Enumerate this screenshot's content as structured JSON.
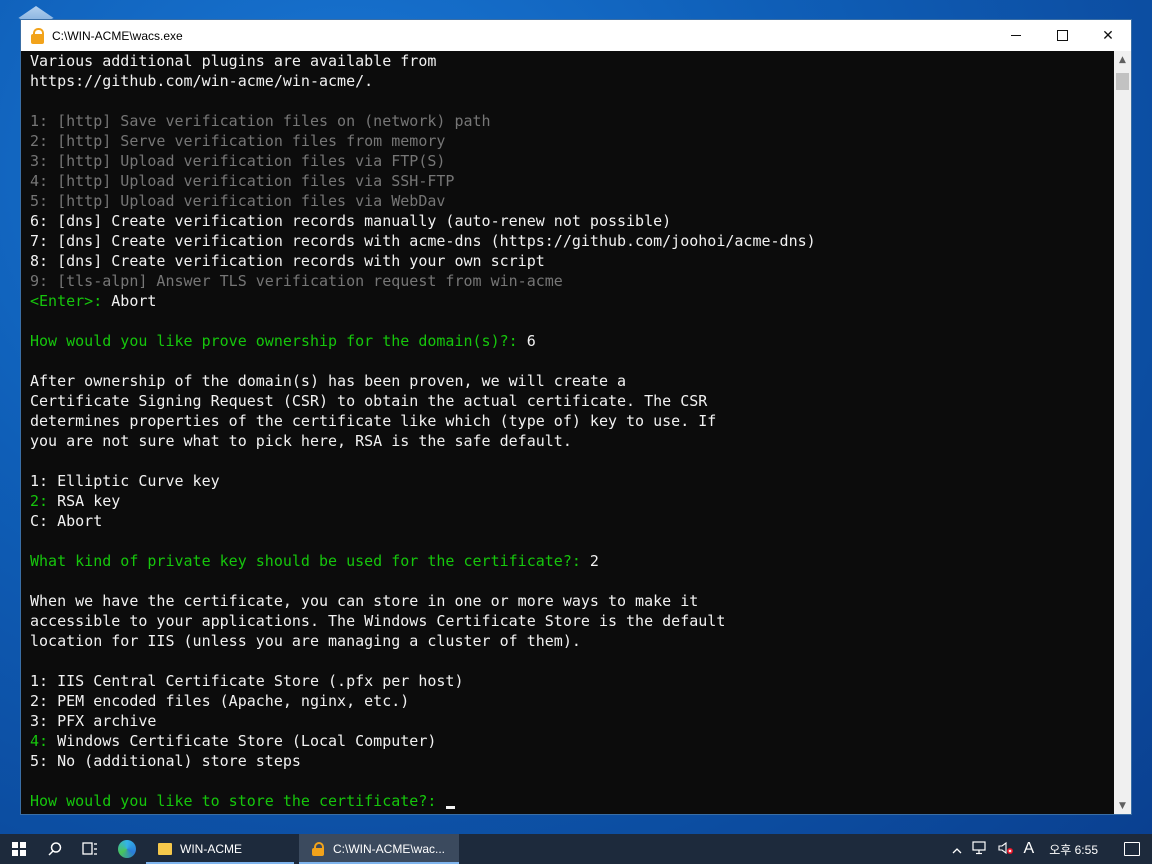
{
  "window": {
    "title": "C:\\WIN-ACME\\wacs.exe",
    "controls": {
      "minimize": "—",
      "maximize": "☐",
      "close": "✕"
    }
  },
  "console": {
    "lines": [
      [
        {
          "t": "Various additional plugins are available from",
          "c": "w"
        }
      ],
      [
        {
          "t": "https://github.com/win-acme/win-acme/.",
          "c": "w"
        }
      ],
      [],
      [
        {
          "t": "1: [http] Save verification files on (network) path",
          "c": "d"
        }
      ],
      [
        {
          "t": "2: [http] Serve verification files from memory",
          "c": "d"
        }
      ],
      [
        {
          "t": "3: [http] Upload verification files via FTP(S)",
          "c": "d"
        }
      ],
      [
        {
          "t": "4: [http] Upload verification files via SSH-FTP",
          "c": "d"
        }
      ],
      [
        {
          "t": "5: [http] Upload verification files via WebDav",
          "c": "d"
        }
      ],
      [
        {
          "t": "6: [dns] Create verification records manually (auto-renew not possible)",
          "c": "w"
        }
      ],
      [
        {
          "t": "7: [dns] Create verification records with acme-dns (https://github.com/joohoi/acme-dns)",
          "c": "w"
        }
      ],
      [
        {
          "t": "8: [dns] Create verification records with your own script",
          "c": "w"
        }
      ],
      [
        {
          "t": "9: [tls-alpn] Answer TLS verification request from win-acme",
          "c": "d"
        }
      ],
      [
        {
          "t": "<Enter>: ",
          "c": "g"
        },
        {
          "t": "Abort",
          "c": "w"
        }
      ],
      [],
      [
        {
          "t": "How would you like prove ownership for the domain(s)?: ",
          "c": "g"
        },
        {
          "t": "6",
          "c": "w"
        }
      ],
      [],
      [
        {
          "t": "After ownership of the domain(s) has been proven, we will create a",
          "c": "w"
        }
      ],
      [
        {
          "t": "Certificate Signing Request (CSR) to obtain the actual certificate. The CSR",
          "c": "w"
        }
      ],
      [
        {
          "t": "determines properties of the certificate like which (type of) key to use. If",
          "c": "w"
        }
      ],
      [
        {
          "t": "you are not sure what to pick here, RSA is the safe default.",
          "c": "w"
        }
      ],
      [],
      [
        {
          "t": "1: Elliptic Curve key",
          "c": "w"
        }
      ],
      [
        {
          "t": "2: ",
          "c": "g"
        },
        {
          "t": "RSA key",
          "c": "w"
        }
      ],
      [
        {
          "t": "C: Abort",
          "c": "w"
        }
      ],
      [],
      [
        {
          "t": "What kind of private key should be used for the certificate?: ",
          "c": "g"
        },
        {
          "t": "2",
          "c": "w"
        }
      ],
      [],
      [
        {
          "t": "When we have the certificate, you can store in one or more ways to make it",
          "c": "w"
        }
      ],
      [
        {
          "t": "accessible to your applications. The Windows Certificate Store is the default",
          "c": "w"
        }
      ],
      [
        {
          "t": "location for IIS (unless you are managing a cluster of them).",
          "c": "w"
        }
      ],
      [],
      [
        {
          "t": "1: IIS Central Certificate Store (.pfx per host)",
          "c": "w"
        }
      ],
      [
        {
          "t": "2: PEM encoded files (Apache, nginx, etc.)",
          "c": "w"
        }
      ],
      [
        {
          "t": "3: PFX archive",
          "c": "w"
        }
      ],
      [
        {
          "t": "4: ",
          "c": "g"
        },
        {
          "t": "Windows Certificate Store (Local Computer)",
          "c": "w"
        }
      ],
      [
        {
          "t": "5: No (additional) store steps",
          "c": "w"
        }
      ],
      [],
      [
        {
          "t": "How would you like to store the certificate?: ",
          "c": "g"
        }
      ]
    ]
  },
  "taskbar": {
    "items": [
      {
        "label": "WIN-ACME",
        "icon": "folder-icon"
      },
      {
        "label": "C:\\WIN-ACME\\wac...",
        "icon": "lock-icon"
      }
    ],
    "tray": {
      "chevron": "^",
      "ime": "A",
      "clock": "오후 6:55"
    }
  }
}
